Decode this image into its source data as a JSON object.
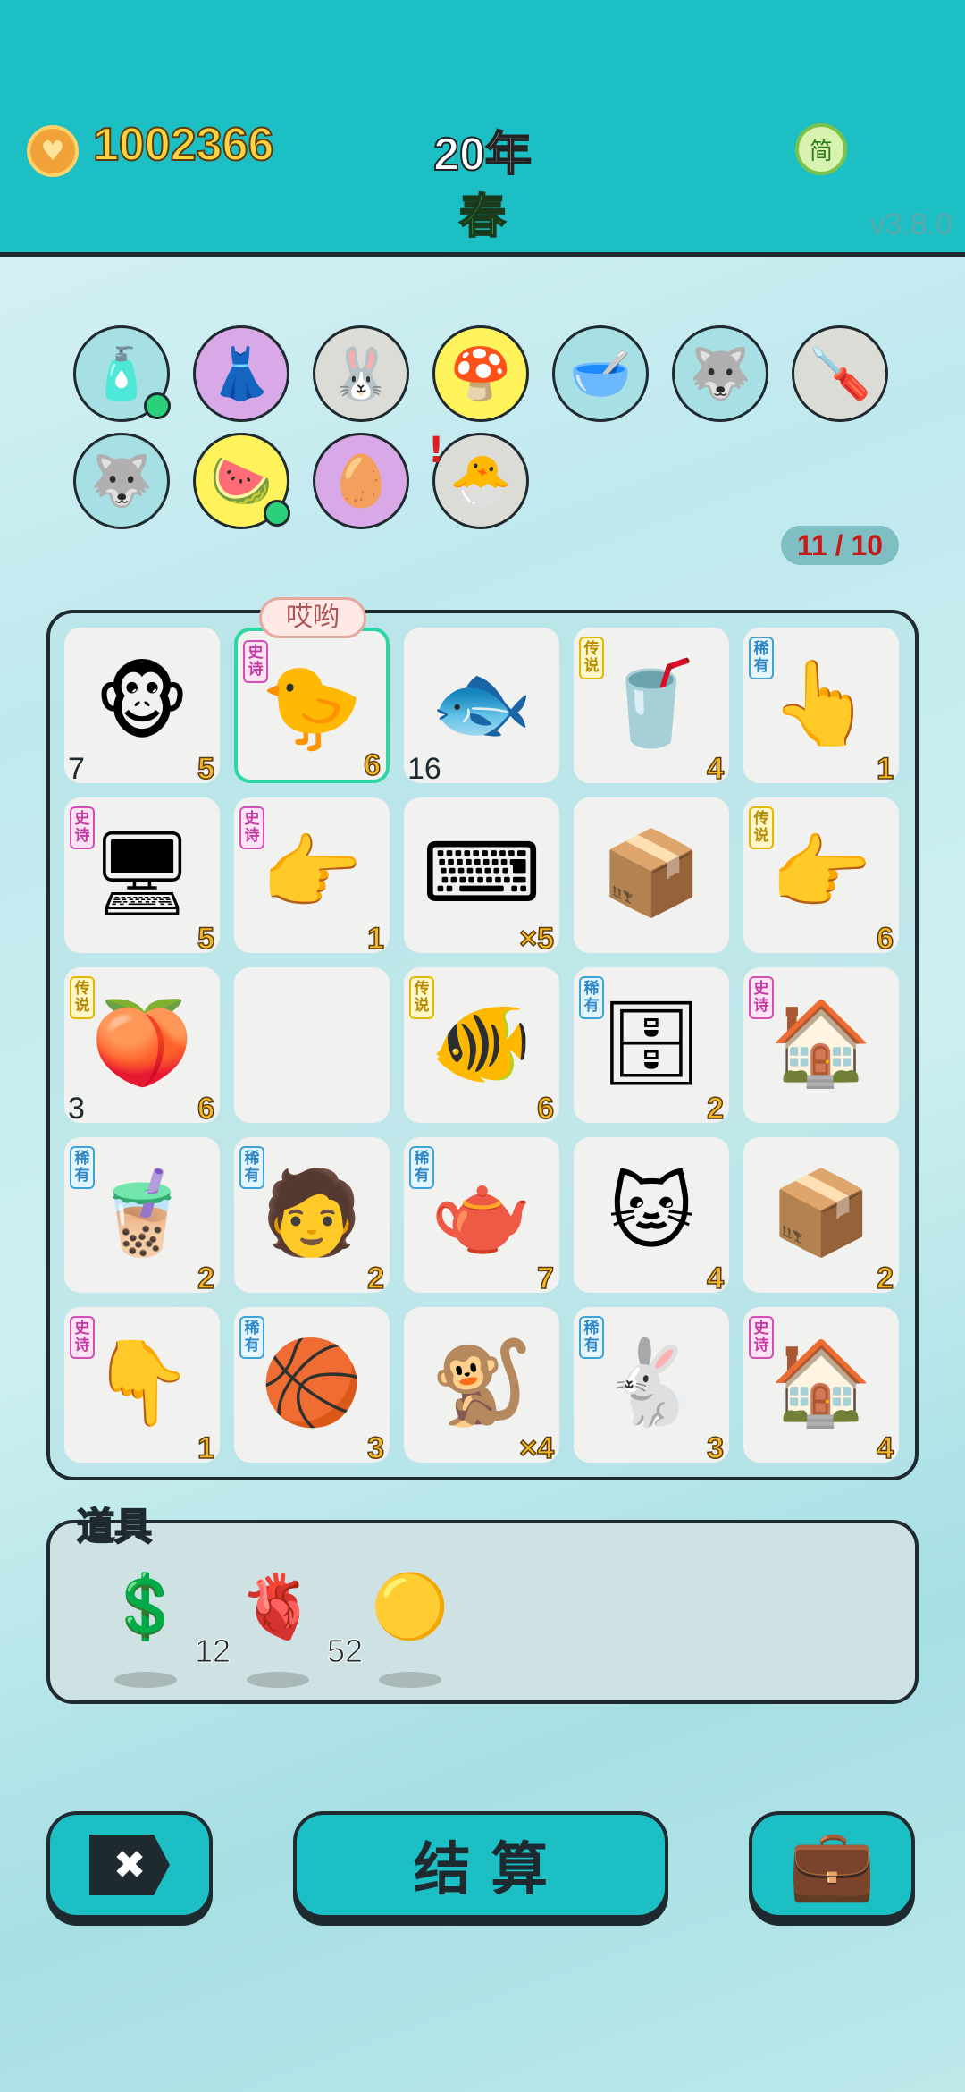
{
  "header": {
    "money": "1002366",
    "year": "20年",
    "season": "春",
    "lang": "简",
    "version": "v3.8.0"
  },
  "traits": [
    {
      "icon": "🧴",
      "bg": "#a7e0e4"
    },
    {
      "icon": "👗",
      "bg": "#d9a8e6"
    },
    {
      "icon": "🐰",
      "bg": "#dcdcd6"
    },
    {
      "icon": "🍄",
      "bg": "#fff35c"
    },
    {
      "icon": "🥣",
      "bg": "#a7e0e4"
    },
    {
      "icon": "🐺",
      "bg": "#a7e0e4"
    },
    {
      "icon": "🪛",
      "bg": "#dcdcd6"
    },
    {
      "icon": "🐺",
      "bg": "#a7e0e4"
    },
    {
      "icon": "🍉",
      "bg": "#fff35c"
    },
    {
      "icon": "🥚",
      "bg": "#d9a8e6"
    },
    {
      "icon": "🐣",
      "bg": "#dcdcd6"
    }
  ],
  "counter": "11 / 10",
  "bubble": "哎哟",
  "tags": {
    "epic": "史诗",
    "rare": "稀有",
    "legend": "传说"
  },
  "grid": [
    {
      "icon": "🐵",
      "tag": "",
      "num": "5",
      "num2": "7"
    },
    {
      "icon": "🐤",
      "tag": "epic",
      "num": "6",
      "num2": ""
    },
    {
      "icon": "🐟",
      "tag": "",
      "num": "",
      "num2": "16"
    },
    {
      "icon": "🥤",
      "tag": "legend",
      "num": "4",
      "num2": ""
    },
    {
      "icon": "👆",
      "tag": "rare",
      "num": "1",
      "num2": ""
    },
    {
      "icon": "🖥",
      "tag": "epic",
      "num": "5",
      "num2": ""
    },
    {
      "icon": "👉",
      "tag": "epic",
      "num": "1",
      "num2": ""
    },
    {
      "icon": "⌨",
      "tag": "",
      "num": "×5",
      "num2": ""
    },
    {
      "icon": "📦",
      "tag": "",
      "num": "",
      "num2": ""
    },
    {
      "icon": "👉",
      "tag": "legend",
      "num": "6",
      "num2": ""
    },
    {
      "icon": "🍑",
      "tag": "legend",
      "num": "6",
      "num2": "3"
    },
    {
      "icon": "",
      "tag": "",
      "num": "",
      "num2": ""
    },
    {
      "icon": "🐠",
      "tag": "legend",
      "num": "6",
      "num2": ""
    },
    {
      "icon": "🗄",
      "tag": "rare",
      "num": "2",
      "num2": ""
    },
    {
      "icon": "🏠",
      "tag": "epic",
      "num": "",
      "num2": ""
    },
    {
      "icon": "🧋",
      "tag": "rare",
      "num": "2",
      "num2": ""
    },
    {
      "icon": "🧑",
      "tag": "rare",
      "num": "2",
      "num2": ""
    },
    {
      "icon": "🫖",
      "tag": "rare",
      "num": "7",
      "num2": ""
    },
    {
      "icon": "🐱",
      "tag": "",
      "num": "4",
      "num2": ""
    },
    {
      "icon": "📦",
      "tag": "",
      "num": "2",
      "num2": ""
    },
    {
      "icon": "👇",
      "tag": "epic",
      "num": "1",
      "num2": ""
    },
    {
      "icon": "🏀",
      "tag": "rare",
      "num": "3",
      "num2": ""
    },
    {
      "icon": "🐒",
      "tag": "",
      "num": "×4",
      "num2": ""
    },
    {
      "icon": "🐇",
      "tag": "rare",
      "num": "3",
      "num2": ""
    },
    {
      "icon": "🏠",
      "tag": "epic",
      "num": "4",
      "num2": ""
    }
  ],
  "props_label": "道具",
  "props": [
    {
      "icon": "💲",
      "count": "12"
    },
    {
      "icon": "🫀",
      "count": "52"
    },
    {
      "icon": "🟡",
      "count": ""
    }
  ],
  "buttons": {
    "close": "✖",
    "settle": "结 算",
    "bag": "💼"
  }
}
